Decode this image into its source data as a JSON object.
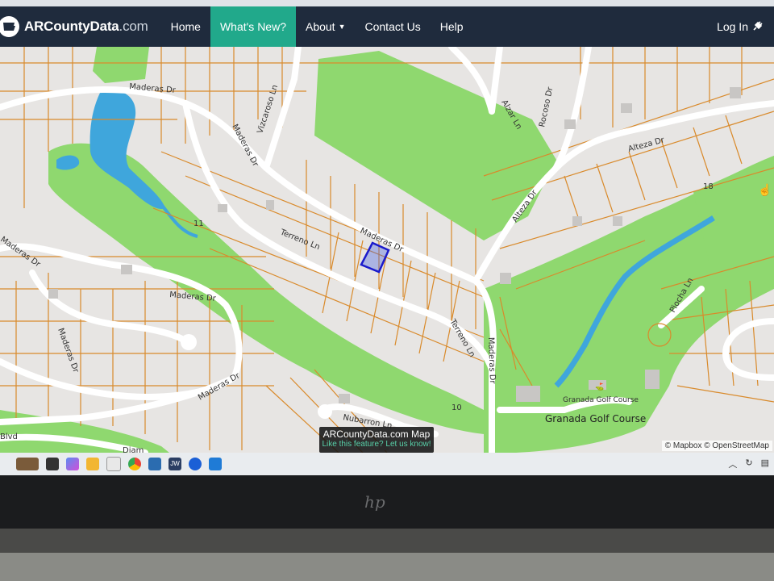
{
  "navbar": {
    "brand": {
      "name": "ARCountyData",
      "domain": ".com"
    },
    "items": [
      {
        "label": "Home"
      },
      {
        "label": "What's New?",
        "active": true
      },
      {
        "label": "About",
        "dropdown": true
      },
      {
        "label": "Contact Us"
      },
      {
        "label": "Help"
      }
    ],
    "login_label": "Log In",
    "colors": {
      "bar": "#1f2b3d",
      "active": "#21a98b"
    }
  },
  "map": {
    "street_labels": [
      "Maderas Dr",
      "Vizcaroso Ln",
      "Maderas Dr",
      "Alzar Ln",
      "Rocoso Dr",
      "Alteza Dr",
      "Alteza Dr",
      "Maderas Dr",
      "Terreno Ln",
      "Maderas Dr",
      "Maderas Dr",
      "Maderas Dr",
      "Maderas Dr",
      "Terreno Ln",
      "Maderas Dr",
      "Piocha Ln",
      "Nubarron Ln",
      "Blvd",
      "Diam"
    ],
    "hole_numbers": [
      "11",
      "18",
      "10"
    ],
    "place_labels": {
      "golf_course": "Granada Golf Course",
      "golf_course_small": "Granada Golf Course"
    },
    "caption": {
      "title": "ARCountyData.com Map",
      "link": "Like this feature? Let us know!"
    },
    "attribution": "© Mapbox © OpenStreetMap",
    "colors": {
      "land": "#e7e5e3",
      "green": "#8fd86f",
      "water": "#3fa6dc",
      "parcel_line": "#d98a2b",
      "selected_parcel": "#1a1acc"
    }
  },
  "taskbar": {
    "icons": [
      "animal-app-icon",
      "file-icon",
      "copilot-icon",
      "folder-icon",
      "snip-icon",
      "chrome-icon",
      "mail-icon",
      "jw-icon",
      "malwarebytes-icon",
      "calendar-icon"
    ],
    "jw_label": "JW"
  },
  "laptop": {
    "logo": "hp"
  }
}
